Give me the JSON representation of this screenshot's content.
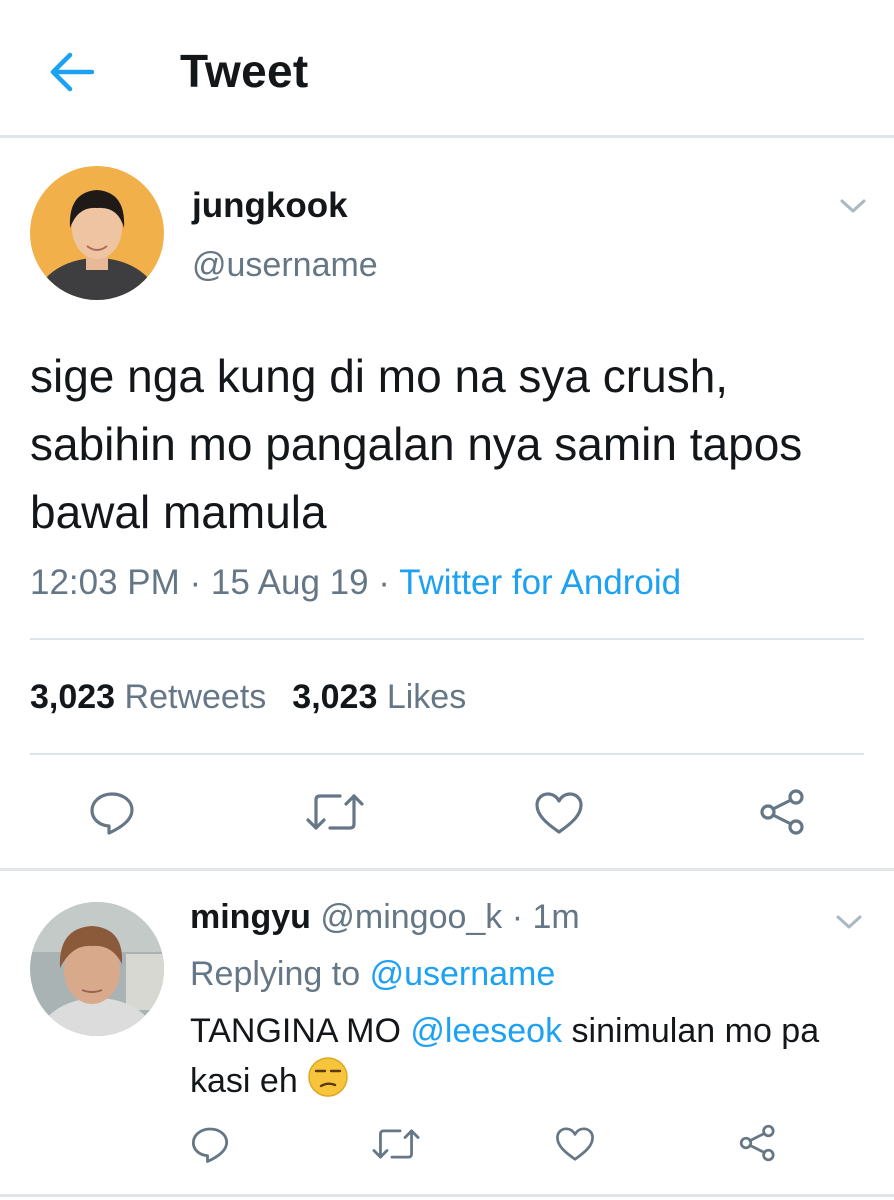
{
  "header": {
    "title": "Tweet",
    "back_icon": "arrow-left-icon"
  },
  "tweet": {
    "author_name": "jungkook",
    "author_handle": "@username",
    "text": "sige nga kung di mo na sya crush, sabihin mo pangalan nya samin tapos bawal mamula",
    "time": "12:03 PM",
    "date": "15 Aug 19",
    "separator": " · ",
    "source": "Twitter for Android",
    "retweets_count": "3,023",
    "retweets_label": "Retweets",
    "likes_count": "3,023",
    "likes_label": "Likes",
    "menu_icon": "chevron-down-icon"
  },
  "reply": {
    "author_name": "mingyu",
    "author_handle": "@mingoo_k",
    "age": "1m",
    "replying_prefix": "Replying to",
    "replying_to": "@username",
    "text_before": "TANGINA MO ",
    "mention": "@leeseok",
    "text_after": " sinimulan mo pa kasi eh",
    "emoji": "unamused-face-emoji"
  },
  "actions": [
    "reply-icon",
    "retweet-icon",
    "like-icon",
    "share-icon"
  ],
  "colors": {
    "accent": "#1da1f2",
    "secondary_text": "#657786",
    "primary_text": "#14171a",
    "divider": "#e1e5e9"
  }
}
